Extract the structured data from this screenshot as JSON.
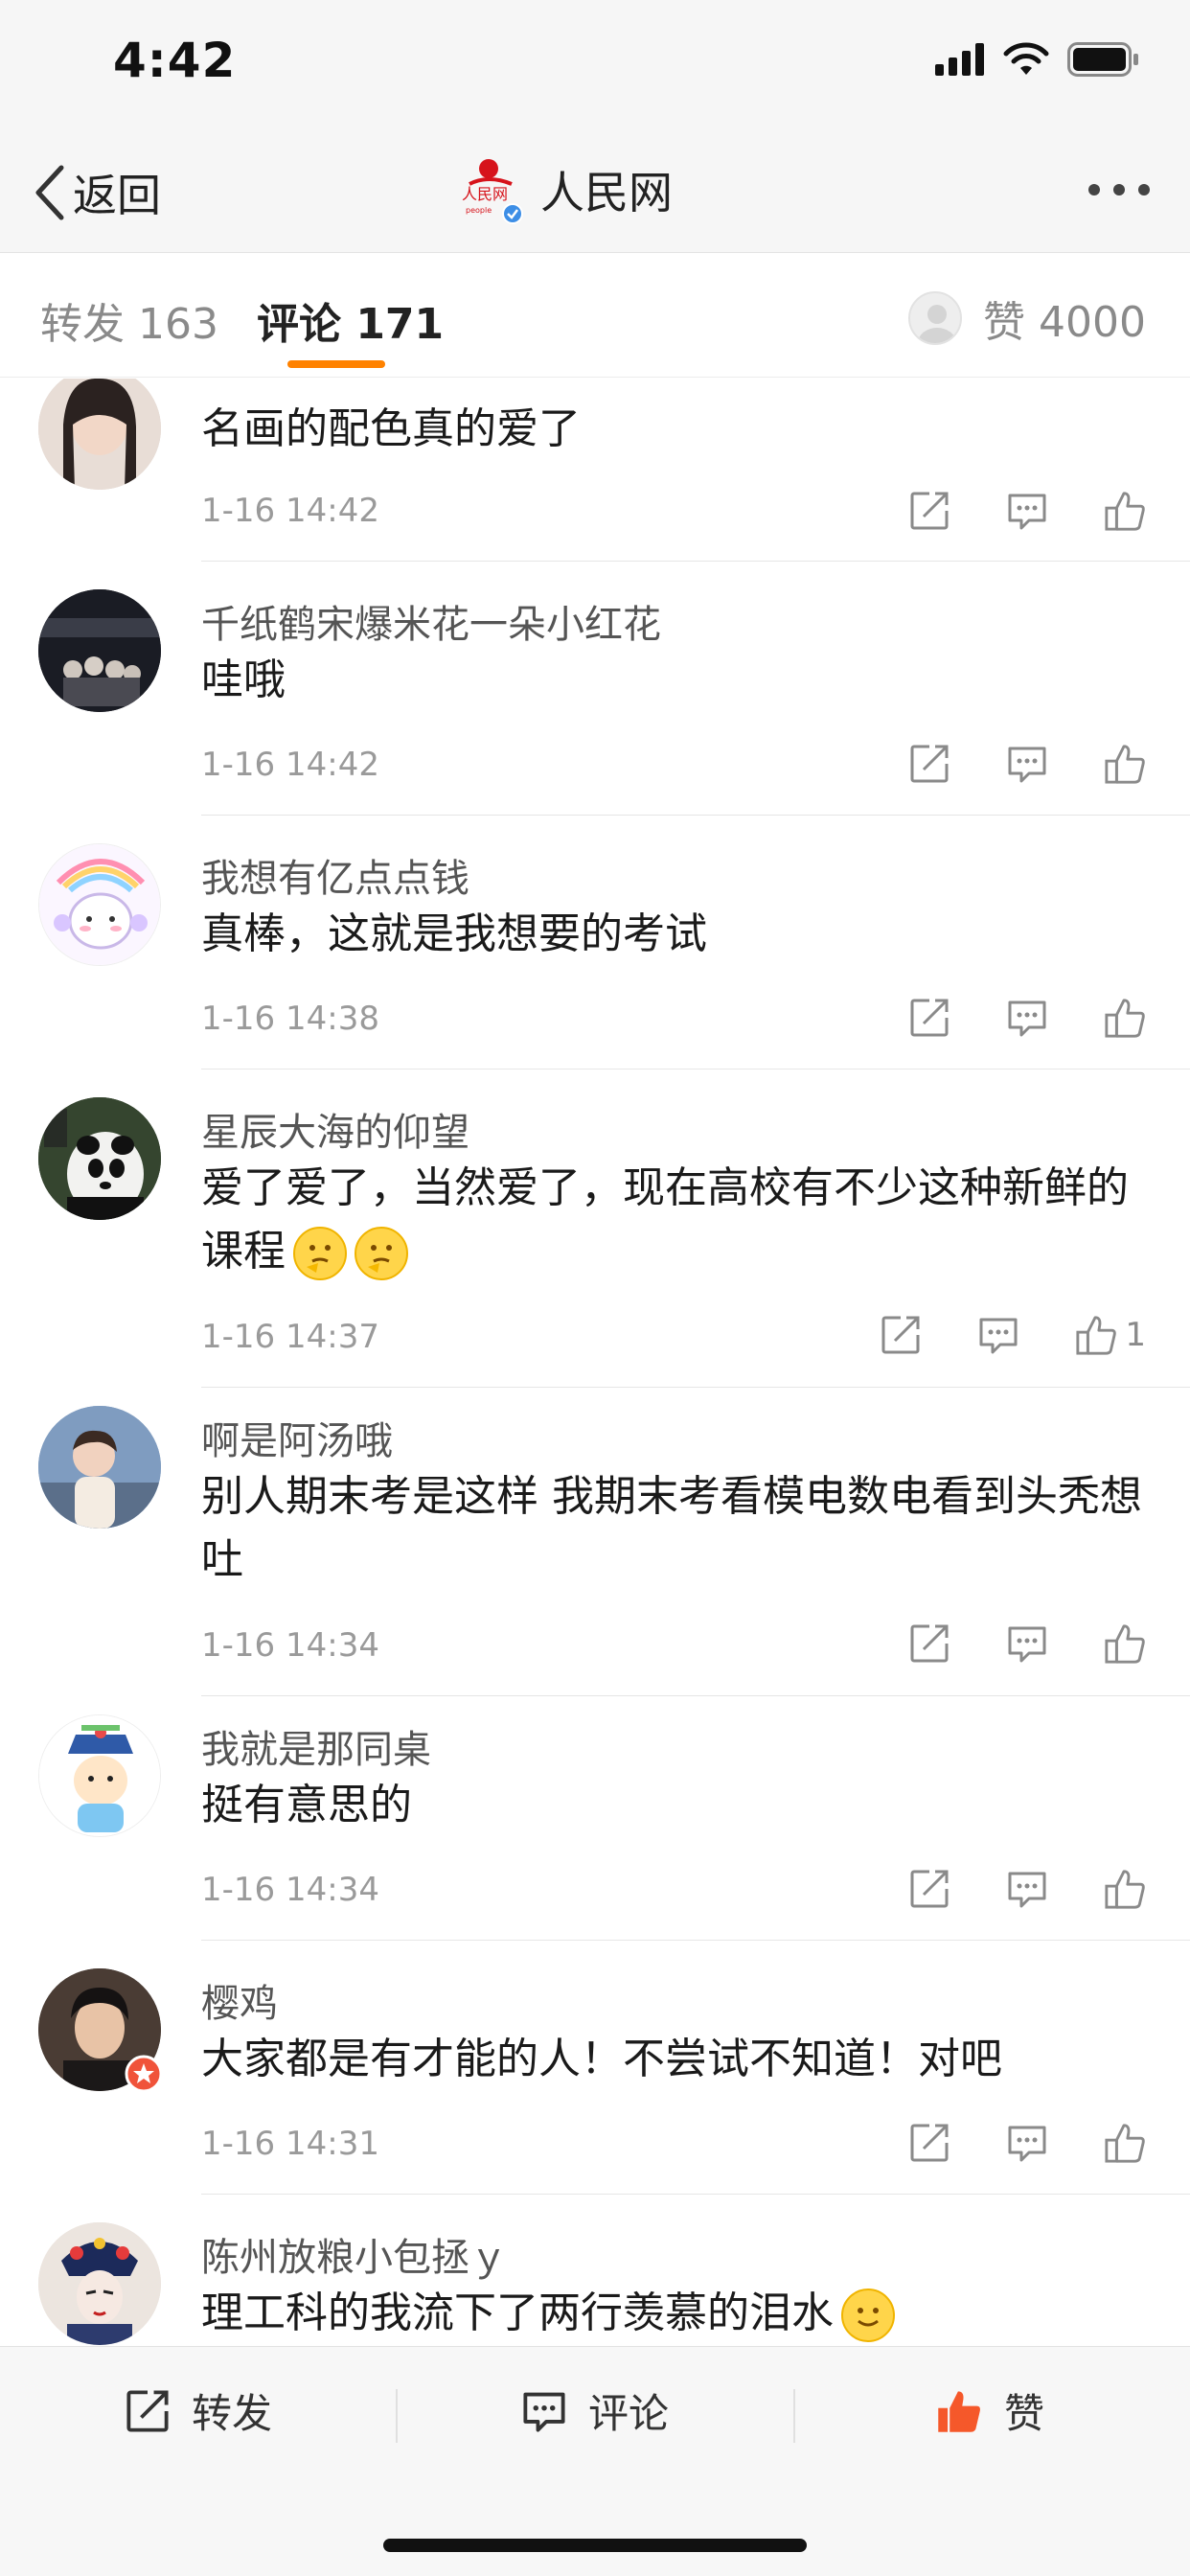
{
  "status_bar": {
    "time": "4:42"
  },
  "nav": {
    "back_label": "返回",
    "title": "人民网"
  },
  "tabs": {
    "repost": "转发 163",
    "comments": "评论 171",
    "likes": "赞 4000"
  },
  "comments": [
    {
      "user": "",
      "text": "名画的配色真的爱了",
      "time": "1-16 14:42",
      "likes": ""
    },
    {
      "user": "千纸鹤宋爆米花一朵小红花",
      "text": "哇哦",
      "time": "1-16 14:42",
      "likes": ""
    },
    {
      "user": "我想有亿点点钱",
      "text": "真棒，这就是我想要的考试",
      "time": "1-16 14:38",
      "likes": ""
    },
    {
      "user": "星辰大海的仰望",
      "text": "爱了爱了，当然爱了，现在高校有不少这种新鲜的课程",
      "time": "1-16 14:37",
      "likes": "1"
    },
    {
      "user": "啊是阿汤哦",
      "text": "别人期末考是这样 我期末考看模电数电看到头秃想吐",
      "time": "1-16 14:34",
      "likes": ""
    },
    {
      "user": "我就是那同桌",
      "text": "挺有意思的",
      "time": "1-16 14:34",
      "likes": ""
    },
    {
      "user": "樱鸡",
      "text": "大家都是有才能的人！不尝试不知道！对吧",
      "time": "1-16 14:31",
      "likes": ""
    },
    {
      "user": "陈州放粮小包拯ｙ",
      "text": "理工科的我流下了两行羡慕的泪水",
      "time": "",
      "likes": ""
    }
  ],
  "bottom_bar": {
    "repost": "转发",
    "comment": "评论",
    "like": "赞"
  },
  "colors": {
    "accent": "#ff8200",
    "like_active": "#f5582a",
    "muted": "#9a9a9a"
  },
  "icons": [
    "back-chevron-icon",
    "verified-badge-icon",
    "more-icon",
    "repost-icon",
    "comment-icon",
    "like-icon",
    "cellular-icon",
    "wifi-icon",
    "battery-icon"
  ]
}
